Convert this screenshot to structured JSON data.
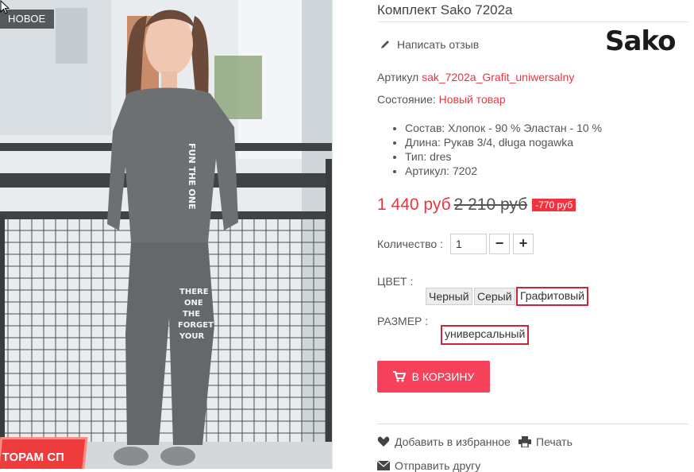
{
  "product": {
    "title": "Комплект Sako 7202a",
    "brand": "Sako",
    "new_label": "НОВОЕ",
    "promo_banner": "ТОРАМ СП",
    "review_label": "Написать отзыв",
    "article_label": "Артикул",
    "article_value": "sak_7202a_Grafit_uniwersalny",
    "condition_label": "Состояние:",
    "condition_value": "Новый товар",
    "features": [
      "Состав: Хлопок - 90 % Эластан - 10 %",
      "Длина: Рукав 3/4, długa nogawka",
      "Тип: dres",
      "Артикул: 7202"
    ],
    "price_current": "1 440 руб",
    "price_old": "2 210 руб",
    "price_discount": "-770 руб",
    "quantity_label": "Количество :",
    "quantity_value": "1",
    "color_label": "ЦВЕТ :",
    "colors": [
      "Черный",
      "Серый",
      "Графитовый"
    ],
    "selected_color": "Графитовый",
    "size_label": "РАЗМЕР :",
    "sizes": [
      "универсальный"
    ],
    "add_to_cart": "В КОРЗИНУ",
    "wishlist": "Добавить в избранное",
    "print": "Печать",
    "send_friend": "Отправить другу"
  },
  "theme": {
    "accent": "#f13340",
    "button": "#f5425a",
    "badge": "#55595c"
  }
}
